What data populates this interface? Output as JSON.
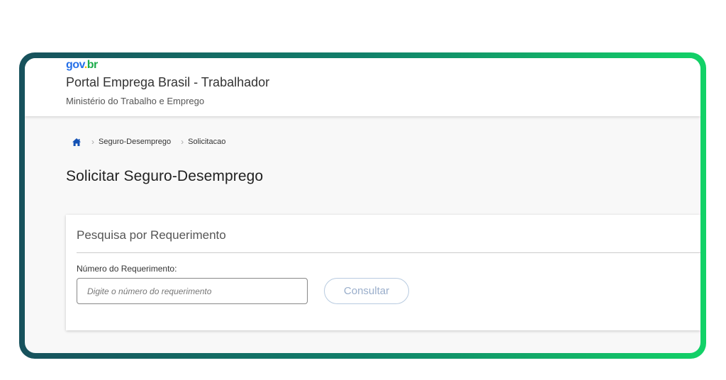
{
  "header": {
    "logo": {
      "part1": "gov",
      "part2": ".",
      "part3": "br"
    },
    "portal_title": "Portal Emprega Brasil - Trabalhador",
    "ministry": "Ministério do Trabalho e Emprego"
  },
  "breadcrumb": {
    "home_icon": "home-icon",
    "items": [
      "Seguro-Desemprego",
      "Solicitacao"
    ]
  },
  "page": {
    "title": "Solicitar Seguro-Desemprego"
  },
  "search_card": {
    "title": "Pesquisa por Requerimento",
    "field_label": "Número do Requerimento:",
    "input_value": "",
    "input_placeholder": "Digite o número do requerimento",
    "button_label": "Consultar"
  },
  "colors": {
    "frame_gradient_start": "#17515c",
    "frame_gradient_end": "#12d267",
    "home_icon": "#1351b4",
    "button_border": "#b8cbe0",
    "button_text": "#9aaecb"
  }
}
